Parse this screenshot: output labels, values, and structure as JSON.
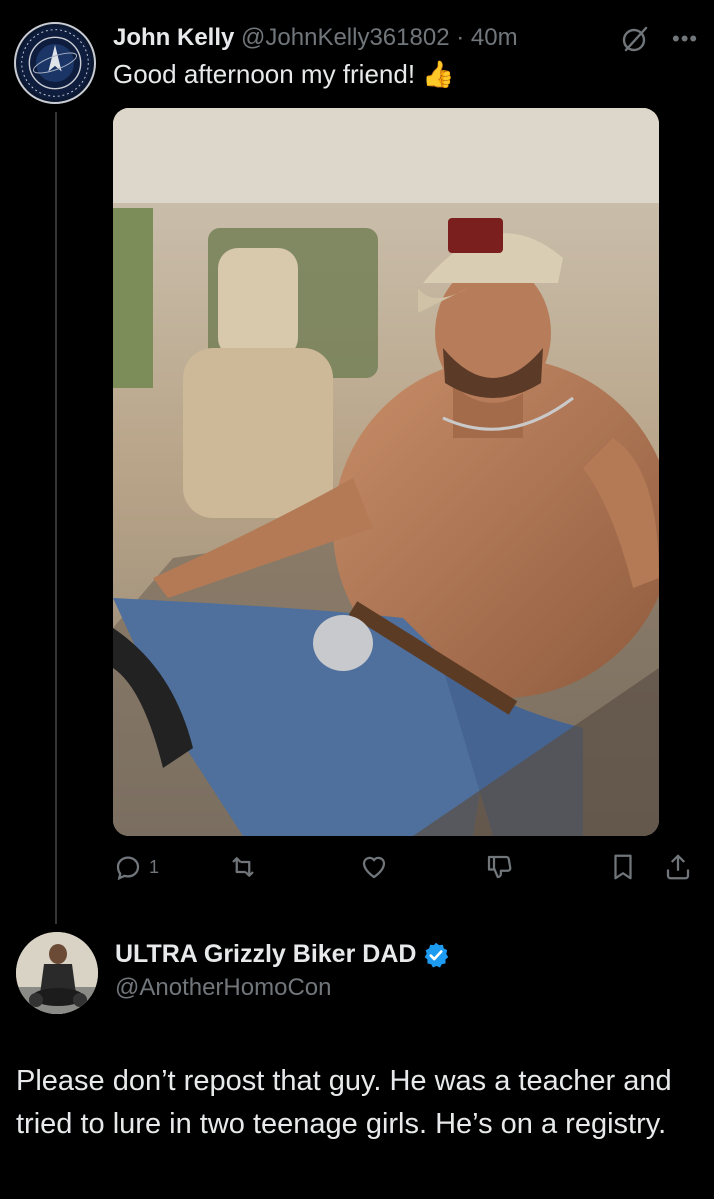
{
  "tweet": {
    "author_name": "John Kelly",
    "author_handle": "@JohnKelly361802",
    "separator": " · ",
    "time": "40m",
    "text": "Good afternoon my friend!",
    "emoji": "👍",
    "avatar_icon": "space-force-seal-icon",
    "media_description_icon": "photo",
    "actions": {
      "reply_count": "1",
      "repost_count": "",
      "like_count": "",
      "views_count": ""
    }
  },
  "reply": {
    "author_name": "ULTRA Grizzly Biker DAD",
    "author_handle": "@AnotherHomoCon",
    "verified": true,
    "text": "Please don’t repost that guy. He was a teacher and tried to lure in two teenage girls. He’s on a registry."
  },
  "colors": {
    "background": "#000000",
    "primary_text": "#e7e9ea",
    "secondary_text": "#71767b",
    "verified_blue": "#1d9bf0"
  }
}
